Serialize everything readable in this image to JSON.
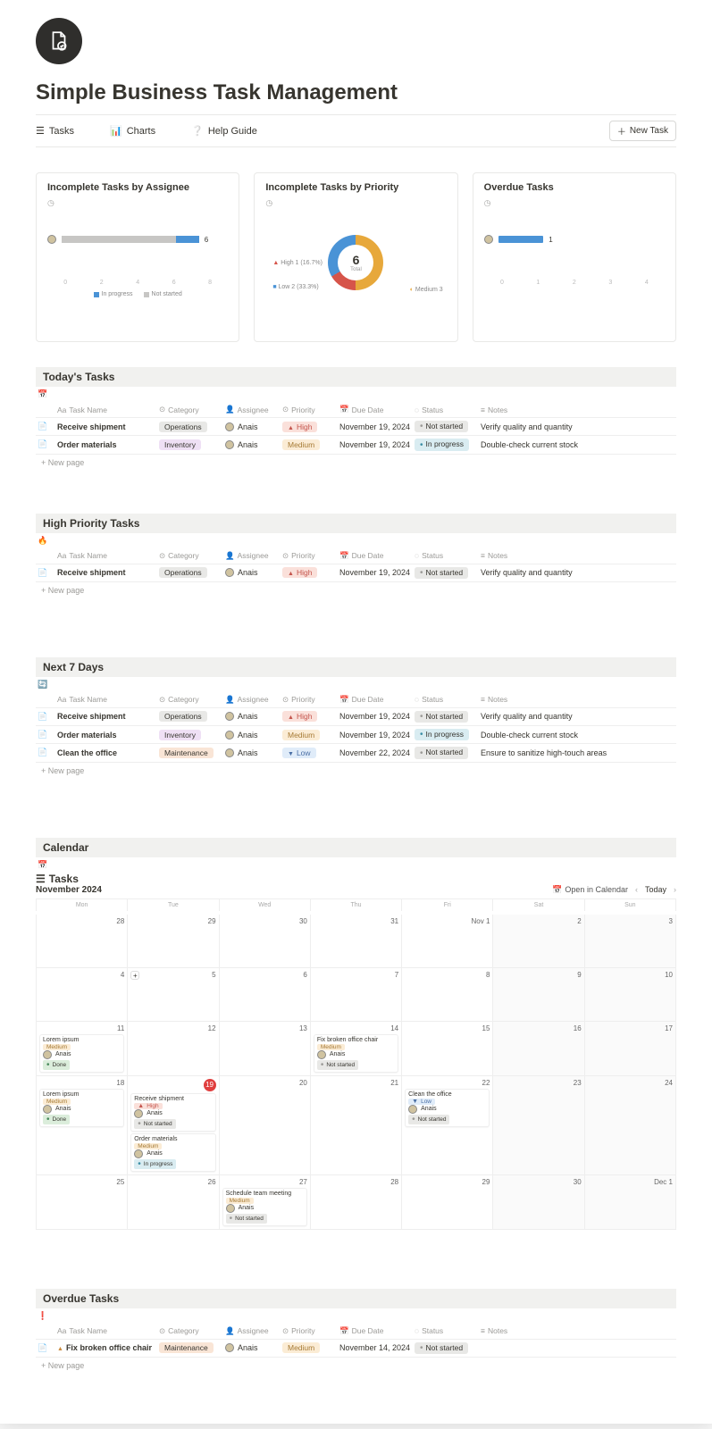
{
  "header": {
    "title": "Simple Business Task Management"
  },
  "nav": {
    "tasks": "Tasks",
    "charts": "Charts",
    "help": "Help Guide",
    "newTask": "New Task"
  },
  "cards": {
    "byAssignee": {
      "title": "Incomplete Tasks by Assignee",
      "value": "6",
      "axis": [
        "0",
        "2",
        "4",
        "6",
        "8"
      ],
      "legend": {
        "inprogress": "In progress",
        "notstarted": "Not started"
      }
    },
    "byPriority": {
      "title": "Incomplete Tasks by Priority",
      "total": "6",
      "totalLabel": "Total",
      "high": "High 1 (16.7%)",
      "medium": "Medium 3",
      "low": "Low 2 (33.3%)"
    },
    "overdue": {
      "title": "Overdue Tasks",
      "value": "1",
      "axis": [
        "0",
        "1",
        "2",
        "3",
        "4"
      ]
    }
  },
  "sections": {
    "today": {
      "title": "Today's Tasks"
    },
    "high": {
      "title": "High Priority Tasks"
    },
    "next7": {
      "title": "Next 7 Days"
    },
    "calendar": {
      "title": "Calendar"
    },
    "overdue": {
      "title": "Overdue Tasks"
    }
  },
  "columns": {
    "taskName": "Task Name",
    "category": "Category",
    "assignee": "Assignee",
    "priority": "Priority",
    "dueDate": "Due Date",
    "status": "Status",
    "notes": "Notes"
  },
  "newPage": "New page",
  "today": [
    {
      "name": "Receive shipment",
      "category": "Operations",
      "catClass": "pill-operations",
      "assignee": "Anais",
      "priority": "High",
      "priClass": "pill-high priority-h",
      "due": "November 19, 2024",
      "status": "Not started",
      "stClass": "pill-notstarted dot-ns",
      "notes": "Verify quality and quantity"
    },
    {
      "name": "Order materials",
      "category": "Inventory",
      "catClass": "pill-inventory",
      "assignee": "Anais",
      "priority": "Medium",
      "priClass": "pill-medium",
      "due": "November 19, 2024",
      "status": "In progress",
      "stClass": "pill-inprogress dot-ip",
      "notes": "Double-check current stock"
    }
  ],
  "highTasks": [
    {
      "name": "Receive shipment",
      "category": "Operations",
      "catClass": "pill-operations",
      "assignee": "Anais",
      "priority": "High",
      "priClass": "pill-high priority-h",
      "due": "November 19, 2024",
      "status": "Not started",
      "stClass": "pill-notstarted dot-ns",
      "notes": "Verify quality and quantity"
    }
  ],
  "next7": [
    {
      "name": "Receive shipment",
      "category": "Operations",
      "catClass": "pill-operations",
      "assignee": "Anais",
      "priority": "High",
      "priClass": "pill-high priority-h",
      "due": "November 19, 2024",
      "status": "Not started",
      "stClass": "pill-notstarted dot-ns",
      "notes": "Verify quality and quantity"
    },
    {
      "name": "Order materials",
      "category": "Inventory",
      "catClass": "pill-inventory",
      "assignee": "Anais",
      "priority": "Medium",
      "priClass": "pill-medium",
      "due": "November 19, 2024",
      "status": "In progress",
      "stClass": "pill-inprogress dot-ip",
      "notes": "Double-check current stock"
    },
    {
      "name": "Clean the office",
      "category": "Maintenance",
      "catClass": "pill-maintenance",
      "assignee": "Anais",
      "priority": "Low",
      "priClass": "pill-low priority-l",
      "due": "November 22, 2024",
      "status": "Not started",
      "stClass": "pill-notstarted dot-ns",
      "notes": "Ensure to sanitize high-touch areas"
    }
  ],
  "overdueTasks": [
    {
      "name": "Fix broken office chair",
      "warn": true,
      "category": "Maintenance",
      "catClass": "pill-maintenance",
      "assignee": "Anais",
      "priority": "Medium",
      "priClass": "pill-medium",
      "due": "November 14, 2024",
      "status": "Not started",
      "stClass": "pill-notstarted dot-ns",
      "notes": ""
    }
  ],
  "calendar": {
    "viewTitle": "Tasks",
    "month": "November 2024",
    "openInCal": "Open in Calendar",
    "today": "Today",
    "dow": [
      "Mon",
      "Tue",
      "Wed",
      "Thu",
      "Fri",
      "Sat",
      "Sun"
    ],
    "weeks": [
      [
        {
          "num": "28",
          "weekend": false
        },
        {
          "num": "29"
        },
        {
          "num": "30"
        },
        {
          "num": "31"
        },
        {
          "num": "Nov 1"
        },
        {
          "num": "2",
          "weekend": true
        },
        {
          "num": "3",
          "weekend": true
        }
      ],
      [
        {
          "num": "4"
        },
        {
          "num": "5",
          "plus": true
        },
        {
          "num": "6"
        },
        {
          "num": "7"
        },
        {
          "num": "8"
        },
        {
          "num": "9",
          "weekend": true
        },
        {
          "num": "10",
          "weekend": true
        }
      ],
      [
        {
          "num": "11",
          "events": [
            {
              "title": "Lorem ipsum",
              "priority": "Medium",
              "priClass": "pill-medium",
              "assignee": "Anais",
              "status": "Done",
              "stClass": "pill-done dot-dn"
            }
          ]
        },
        {
          "num": "12"
        },
        {
          "num": "13"
        },
        {
          "num": "14",
          "events": [
            {
              "title": "Fix broken office chair",
              "priority": "Medium",
              "priClass": "pill-medium",
              "assignee": "Anais",
              "status": "Not started",
              "stClass": "pill-notstarted dot-ns"
            }
          ]
        },
        {
          "num": "15"
        },
        {
          "num": "16",
          "weekend": true
        },
        {
          "num": "17",
          "weekend": true
        }
      ],
      [
        {
          "num": "18",
          "events": [
            {
              "title": "Lorem ipsum",
              "priority": "Medium",
              "priClass": "pill-medium",
              "assignee": "Anais",
              "status": "Done",
              "stClass": "pill-done dot-dn"
            }
          ]
        },
        {
          "num": "19",
          "red": true,
          "events": [
            {
              "title": "Receive shipment",
              "priority": "High",
              "priClass": "pill-high priority-h",
              "assignee": "Anais",
              "status": "Not started",
              "stClass": "pill-notstarted dot-ns"
            },
            {
              "title": "Order materials",
              "priority": "Medium",
              "priClass": "pill-medium",
              "assignee": "Anais",
              "status": "In progress",
              "stClass": "pill-inprogress dot-ip"
            }
          ]
        },
        {
          "num": "20"
        },
        {
          "num": "21"
        },
        {
          "num": "22",
          "events": [
            {
              "title": "Clean the office",
              "priority": "Low",
              "priClass": "pill-low priority-l",
              "assignee": "Anais",
              "status": "Not started",
              "stClass": "pill-notstarted dot-ns"
            }
          ]
        },
        {
          "num": "23",
          "weekend": true
        },
        {
          "num": "24",
          "weekend": true
        }
      ],
      [
        {
          "num": "25"
        },
        {
          "num": "26"
        },
        {
          "num": "27",
          "events": [
            {
              "title": "Schedule team meeting",
              "priority": "Medium",
              "priClass": "pill-medium",
              "assignee": "Anais",
              "status": "Not started",
              "stClass": "pill-notstarted dot-ns"
            }
          ]
        },
        {
          "num": "28"
        },
        {
          "num": "29"
        },
        {
          "num": "30",
          "weekend": true
        },
        {
          "num": "Dec 1",
          "weekend": true
        }
      ]
    ]
  },
  "chart_data": [
    {
      "type": "bar",
      "title": "Incomplete Tasks by Assignee",
      "orientation": "horizontal",
      "categories": [
        "Anais"
      ],
      "series": [
        {
          "name": "In progress",
          "values": [
            1
          ]
        },
        {
          "name": "Not started",
          "values": [
            5
          ]
        }
      ],
      "xlabel": "",
      "ylabel": "",
      "xlim": [
        0,
        8
      ]
    },
    {
      "type": "pie",
      "title": "Incomplete Tasks by Priority",
      "categories": [
        "High",
        "Medium",
        "Low"
      ],
      "values": [
        1,
        3,
        2
      ],
      "total": 6
    },
    {
      "type": "bar",
      "title": "Overdue Tasks",
      "orientation": "horizontal",
      "categories": [
        "Anais"
      ],
      "values": [
        1
      ],
      "xlim": [
        0,
        4
      ]
    }
  ]
}
